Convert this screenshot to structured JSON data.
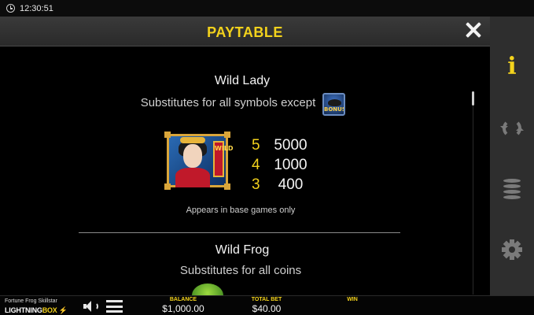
{
  "status": {
    "time": "12:30:51"
  },
  "header": {
    "title": "PAYTABLE"
  },
  "sidebar": {
    "items": [
      {
        "icon": "info-icon",
        "active": true
      },
      {
        "icon": "refresh-icon",
        "active": false
      },
      {
        "icon": "coins-icon",
        "active": false
      },
      {
        "icon": "gear-icon",
        "active": false
      }
    ]
  },
  "paytable": {
    "wild_lady": {
      "title": "Wild Lady",
      "description": "Substitutes for all symbols except",
      "except_icon": "bonus-symbol-icon",
      "except_icon_text": "BONUS",
      "symbol_text": "WILD",
      "payouts": [
        {
          "count": "5",
          "value": "5000"
        },
        {
          "count": "4",
          "value": "1000"
        },
        {
          "count": "3",
          "value": "400"
        }
      ],
      "note": "Appears in base games only"
    },
    "wild_frog": {
      "title": "Wild Frog",
      "description": "Substitutes for all coins"
    }
  },
  "footer": {
    "game_name": "Fortune Frog Skillstar",
    "brand_main": "LIGHTNING",
    "brand_accent": "BOX",
    "balance_label": "BALANCE",
    "balance_value": "$1,000.00",
    "total_bet_label": "TOTAL BET",
    "total_bet_value": "$40.00",
    "win_label": "WIN",
    "win_value": ""
  },
  "colors": {
    "accent": "#f3d21c",
    "header_bg": "#333333",
    "sidebar_bg": "#2e2e2e",
    "background": "#000000"
  }
}
